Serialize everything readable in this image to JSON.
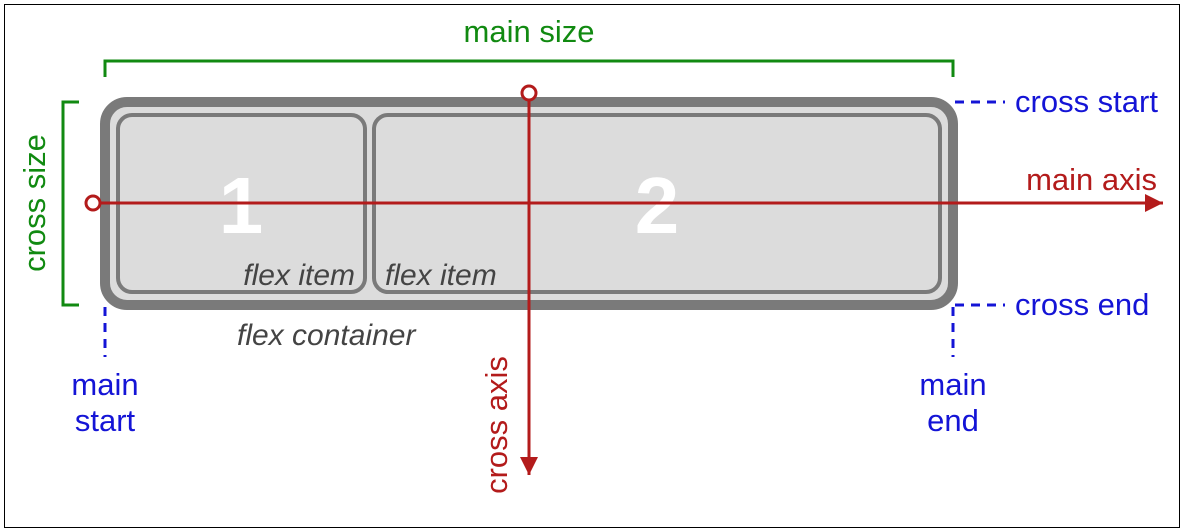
{
  "labels": {
    "main_size": "main size",
    "cross_size": "cross size",
    "main_axis": "main axis",
    "cross_axis": "cross axis",
    "main_start": "main",
    "main_start2": "start",
    "main_end": "main",
    "main_end2": "end",
    "cross_start": "cross start",
    "cross_end": "cross end",
    "flex_item": "flex item",
    "flex_container": "flex container",
    "item1": "1",
    "item2": "2"
  },
  "colors": {
    "green": "#118a11",
    "blue": "#1414d6",
    "red": "#b31b1b",
    "grey_border": "#7a7a7a",
    "grey_fill": "#dcdcdc"
  }
}
